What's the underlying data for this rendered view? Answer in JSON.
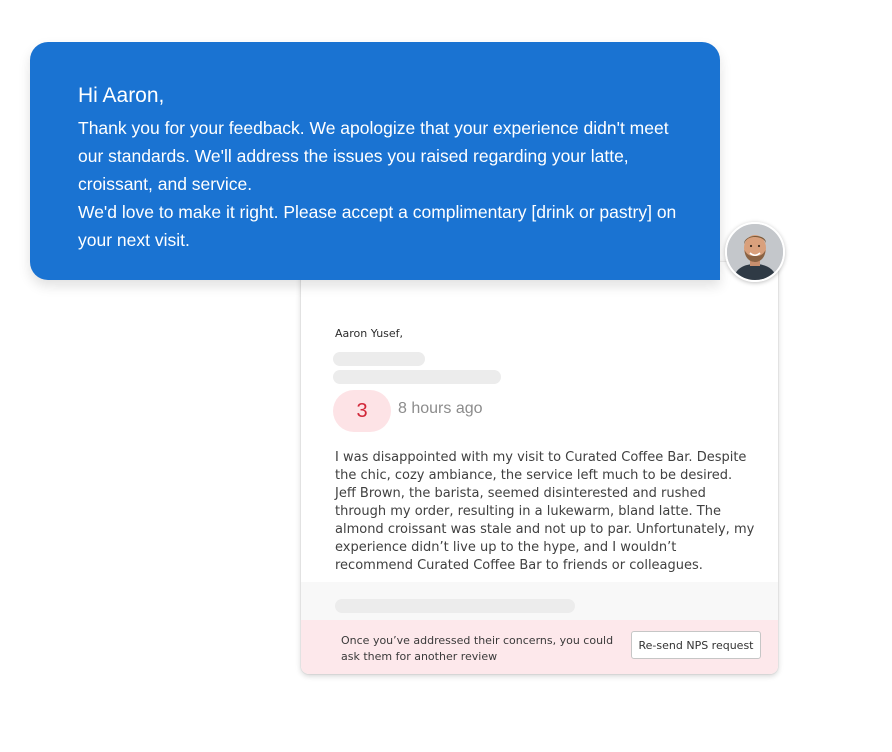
{
  "reply": {
    "greeting": "Hi Aaron,",
    "body_lines": [
      "Thank you for your feedback. We apologize that your experience didn't meet our standards. We'll address the issues you raised regarding your latte, croissant, and service.",
      "We'd love to make it right. Please accept a complimentary [drink or pastry] on your next visit."
    ],
    "bubble_color": "#1a73d2"
  },
  "avatar": {
    "icon": "user-avatar-photo"
  },
  "review": {
    "reviewer_name": "Aaron Yusef,",
    "score": "3",
    "score_color": "#d12638",
    "time_ago": "8 hours ago",
    "text": "I was disappointed with my visit to Curated Coffee Bar. Despite the chic, cozy ambiance, the service left much to be desired. Jeff Brown, the barista, seemed disinterested and rushed through my order, resulting in a lukewarm, bland latte. The almond croissant was stale and not up to par. Unfortunately, my experience didn’t live up to the hype, and I wouldn’t recommend Curated Coffee Bar to friends or colleagues."
  },
  "footer": {
    "message": "Once you’ve addressed their concerns, you could ask them for another review",
    "button_label": "Re-send NPS request",
    "background_color": "#fde8eb"
  }
}
